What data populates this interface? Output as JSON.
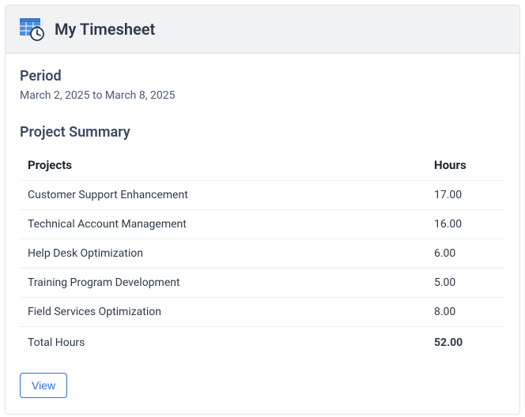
{
  "header": {
    "title": "My Timesheet"
  },
  "period": {
    "heading": "Period",
    "range": "March 2, 2025 to March 8, 2025"
  },
  "summary": {
    "heading": "Project Summary",
    "columns": {
      "projects": "Projects",
      "hours": "Hours"
    },
    "rows": [
      {
        "project": "Customer Support Enhancement",
        "hours": "17.00"
      },
      {
        "project": "Technical Account Management",
        "hours": "16.00"
      },
      {
        "project": "Help Desk Optimization",
        "hours": "6.00"
      },
      {
        "project": "Training Program Development",
        "hours": "5.00"
      },
      {
        "project": "Field Services Optimization",
        "hours": "8.00"
      }
    ],
    "total": {
      "label": "Total Hours",
      "value": "52.00"
    }
  },
  "actions": {
    "view": "View"
  }
}
